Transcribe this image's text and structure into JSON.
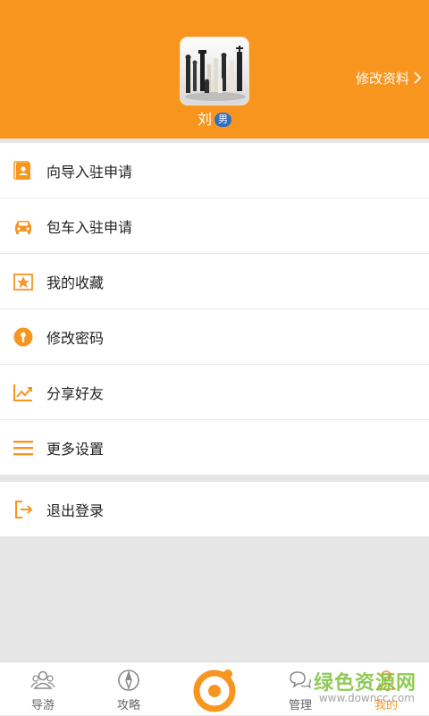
{
  "profile": {
    "name": "刘",
    "gender": "男",
    "edit_label": "修改资料"
  },
  "menu": [
    {
      "label": "向导入驻申请",
      "icon": "guide-application-icon"
    },
    {
      "label": "包车入驻申请",
      "icon": "car-icon"
    },
    {
      "label": "我的收藏",
      "icon": "star-icon"
    },
    {
      "label": "修改密码",
      "icon": "keyhole-icon"
    },
    {
      "label": "分享好友",
      "icon": "trend-chart-icon"
    },
    {
      "label": "更多设置",
      "icon": "menu-lines-icon"
    }
  ],
  "logout": {
    "label": "退出登录",
    "icon": "logout-icon"
  },
  "tabs": [
    {
      "label": "导游",
      "icon": "people-icon",
      "active": false
    },
    {
      "label": "攻略",
      "icon": "compass-icon",
      "active": false
    },
    {
      "label": "",
      "icon": "center-logo-icon",
      "active": false
    },
    {
      "label": "管理",
      "icon": "chat-icon",
      "active": false
    },
    {
      "label": "我的",
      "icon": "user-icon",
      "active": true
    }
  ],
  "watermark": {
    "main": "绿色资源网",
    "sub": "www.downcc.com"
  },
  "colors": {
    "accent": "#f8951e",
    "gender_badge": "#2d6fc3"
  }
}
